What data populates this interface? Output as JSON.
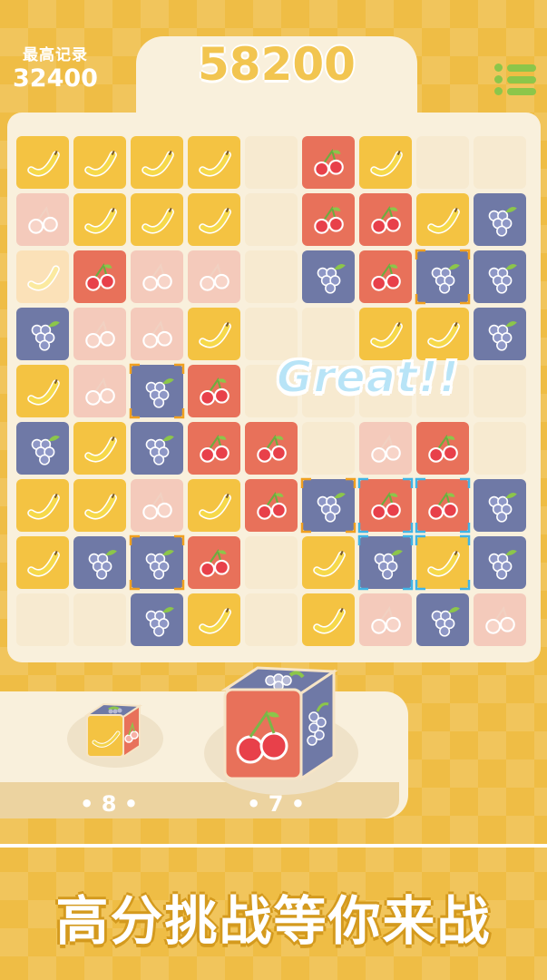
{
  "hud": {
    "best_label": "最高记录",
    "best_value": "32400",
    "score": "58200",
    "menu_icon": "list-menu-icon"
  },
  "board": {
    "legend": {
      "b": "banana",
      "c": "cherry",
      "g": "grape",
      "pb": "faded-banana",
      "pc": "faded-cherry",
      "e": "empty"
    },
    "rows": [
      [
        "b",
        "b",
        "b",
        "b",
        "e",
        "c",
        "b",
        "e",
        "e"
      ],
      [
        "pc",
        "b",
        "b",
        "b",
        "e",
        "c",
        "c",
        "b",
        "g"
      ],
      [
        "pb",
        "c",
        "pc",
        "pc",
        "e",
        "g",
        "c",
        "g",
        "g"
      ],
      [
        "g",
        "pc",
        "pc",
        "b",
        "e",
        "e",
        "b",
        "b",
        "g"
      ],
      [
        "b",
        "pc",
        "g",
        "c",
        "e",
        "e",
        "e",
        "e",
        "e"
      ],
      [
        "g",
        "b",
        "g",
        "c",
        "c",
        "e",
        "pc",
        "c",
        "e"
      ],
      [
        "b",
        "b",
        "pc",
        "b",
        "c",
        "g",
        "c",
        "c",
        "g"
      ],
      [
        "b",
        "g",
        "g",
        "c",
        "e",
        "b",
        "g",
        "b",
        "g"
      ],
      [
        "e",
        "e",
        "g",
        "b",
        "e",
        "b",
        "pc",
        "g",
        "pc"
      ]
    ],
    "selected_orange": [
      [
        2,
        7
      ],
      [
        4,
        2
      ],
      [
        6,
        5
      ],
      [
        7,
        2
      ]
    ],
    "selected_blue": [
      [
        6,
        6
      ],
      [
        6,
        7
      ],
      [
        7,
        6
      ],
      [
        7,
        7
      ]
    ],
    "combo_text": "Great!!"
  },
  "tray": {
    "cube_small": {
      "front": "banana",
      "side": "cherry",
      "top": "grape"
    },
    "cube_large": {
      "front": "cherry",
      "side": "grape",
      "top": "grape"
    },
    "count_1": "• 8 •",
    "count_2": "• 7 •"
  },
  "slogan": "高分挑战等你来战",
  "colors": {
    "background": "#efbd45",
    "banana_tile": "#f4c342",
    "cherry_tile": "#e8715a",
    "grape_tile": "#6f79a6",
    "panel": "#f9f0dc",
    "menu_green": "#8cc64a"
  }
}
